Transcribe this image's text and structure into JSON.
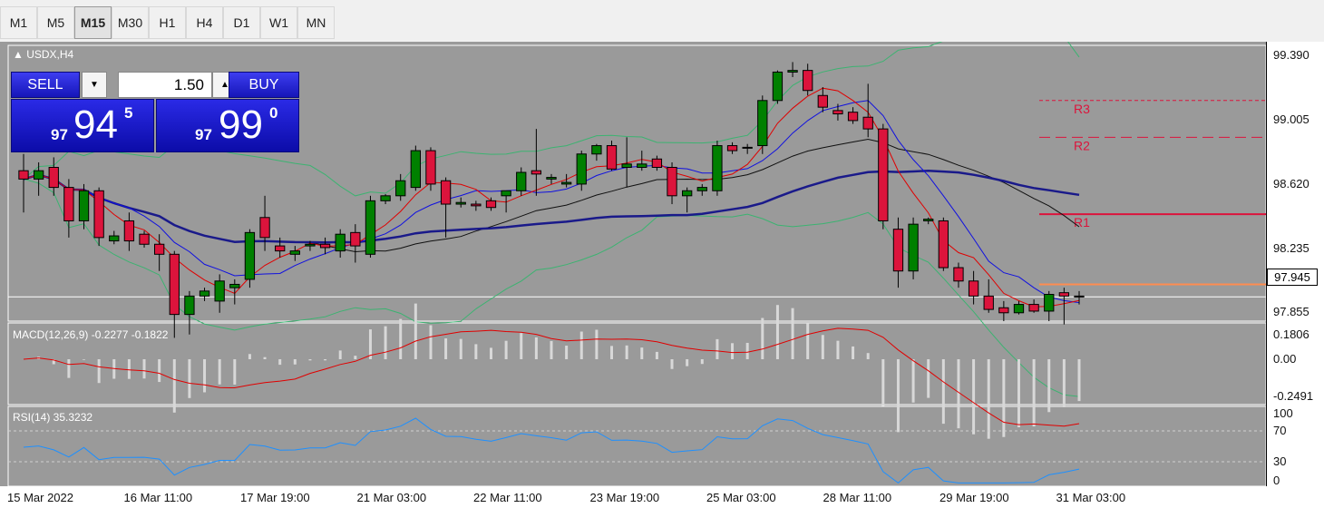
{
  "timeframes": [
    {
      "label": "M1",
      "active": false
    },
    {
      "label": "M5",
      "active": false
    },
    {
      "label": "M15",
      "active": true
    },
    {
      "label": "M30",
      "active": false
    },
    {
      "label": "H1",
      "active": false
    },
    {
      "label": "H4",
      "active": false
    },
    {
      "label": "D1",
      "active": false
    },
    {
      "label": "W1",
      "active": false
    },
    {
      "label": "MN",
      "active": false
    }
  ],
  "chart": {
    "symbol_label": "USDX,H4",
    "current_price": "97.945",
    "price_ticks": [
      "99.390",
      "99.005",
      "98.620",
      "98.235",
      "97.855"
    ],
    "pivot_labels": [
      "R3",
      "R2",
      "R1"
    ],
    "time_labels": [
      "15 Mar 2022",
      "16 Mar 11:00",
      "17 Mar 19:00",
      "21 Mar 03:00",
      "22 Mar 11:00",
      "23 Mar 19:00",
      "25 Mar 03:00",
      "28 Mar 11:00",
      "29 Mar 19:00",
      "31 Mar 03:00"
    ],
    "colors": {
      "background": "#9a9a9a",
      "bull": "#008000",
      "bear": "#dc143c",
      "macd_hist": "#d8d8d8",
      "macd_signal": "#e00000",
      "rsi": "#1e90ff",
      "pivot_r": "#dc143c",
      "pivot_pp": "#ff8c50"
    }
  },
  "trade_panel": {
    "sell_label": "SELL",
    "buy_label": "BUY",
    "lot_value": "1.50",
    "sell_price_prefix": "97",
    "sell_price_big": "94",
    "sell_price_sup": "5",
    "buy_price_prefix": "97",
    "buy_price_big": "99",
    "buy_price_sup": "0"
  },
  "macd": {
    "label": "MACD(12,26,9) -0.2277 -0.1822",
    "ticks": [
      "0.1806",
      "0.00",
      "-0.2491"
    ]
  },
  "rsi": {
    "label": "RSI(14) 35.3232",
    "ticks": [
      "100",
      "70",
      "30",
      "0"
    ]
  },
  "chart_data": {
    "type": "candlestick",
    "title": "USDX,H4",
    "ylim": [
      97.8,
      99.45
    ],
    "candles": [
      {
        "o": 98.7,
        "h": 98.8,
        "l": 98.45,
        "c": 98.65
      },
      {
        "o": 98.65,
        "h": 98.75,
        "l": 98.55,
        "c": 98.7
      },
      {
        "o": 98.72,
        "h": 98.78,
        "l": 98.55,
        "c": 98.6
      },
      {
        "o": 98.6,
        "h": 98.65,
        "l": 98.3,
        "c": 98.4
      },
      {
        "o": 98.4,
        "h": 98.62,
        "l": 98.35,
        "c": 98.58
      },
      {
        "o": 98.58,
        "h": 98.6,
        "l": 98.25,
        "c": 98.3
      },
      {
        "o": 98.28,
        "h": 98.34,
        "l": 98.26,
        "c": 98.31
      },
      {
        "o": 98.4,
        "h": 98.45,
        "l": 98.22,
        "c": 98.28
      },
      {
        "o": 98.32,
        "h": 98.34,
        "l": 98.24,
        "c": 98.26
      },
      {
        "o": 98.26,
        "h": 98.32,
        "l": 98.1,
        "c": 98.2
      },
      {
        "o": 98.2,
        "h": 98.22,
        "l": 97.7,
        "c": 97.84
      },
      {
        "o": 97.84,
        "h": 97.98,
        "l": 97.72,
        "c": 97.95
      },
      {
        "o": 97.95,
        "h": 98.0,
        "l": 97.92,
        "c": 97.98
      },
      {
        "o": 97.92,
        "h": 98.08,
        "l": 97.85,
        "c": 98.04
      },
      {
        "o": 98.0,
        "h": 98.05,
        "l": 97.9,
        "c": 98.02
      },
      {
        "o": 98.05,
        "h": 98.35,
        "l": 98.0,
        "c": 98.33
      },
      {
        "o": 98.42,
        "h": 98.55,
        "l": 98.22,
        "c": 98.3
      },
      {
        "o": 98.25,
        "h": 98.3,
        "l": 98.18,
        "c": 98.22
      },
      {
        "o": 98.2,
        "h": 98.25,
        "l": 98.16,
        "c": 98.22
      },
      {
        "o": 98.25,
        "h": 98.28,
        "l": 98.22,
        "c": 98.26
      },
      {
        "o": 98.26,
        "h": 98.3,
        "l": 98.2,
        "c": 98.24
      },
      {
        "o": 98.22,
        "h": 98.35,
        "l": 98.18,
        "c": 98.32
      },
      {
        "o": 98.33,
        "h": 98.38,
        "l": 98.15,
        "c": 98.25
      },
      {
        "o": 98.2,
        "h": 98.55,
        "l": 98.18,
        "c": 98.52
      },
      {
        "o": 98.52,
        "h": 98.56,
        "l": 98.5,
        "c": 98.55
      },
      {
        "o": 98.55,
        "h": 98.68,
        "l": 98.52,
        "c": 98.64
      },
      {
        "o": 98.6,
        "h": 98.85,
        "l": 98.58,
        "c": 98.82
      },
      {
        "o": 98.82,
        "h": 98.84,
        "l": 98.58,
        "c": 98.62
      },
      {
        "o": 98.64,
        "h": 98.66,
        "l": 98.3,
        "c": 98.5
      },
      {
        "o": 98.5,
        "h": 98.54,
        "l": 98.48,
        "c": 98.51
      },
      {
        "o": 98.5,
        "h": 98.52,
        "l": 98.46,
        "c": 98.49
      },
      {
        "o": 98.52,
        "h": 98.54,
        "l": 98.46,
        "c": 98.48
      },
      {
        "o": 98.55,
        "h": 98.58,
        "l": 98.45,
        "c": 98.58
      },
      {
        "o": 98.58,
        "h": 98.72,
        "l": 98.55,
        "c": 98.69
      },
      {
        "o": 98.7,
        "h": 98.95,
        "l": 98.55,
        "c": 98.68
      },
      {
        "o": 98.65,
        "h": 98.68,
        "l": 98.62,
        "c": 98.66
      },
      {
        "o": 98.62,
        "h": 98.68,
        "l": 98.6,
        "c": 98.63
      },
      {
        "o": 98.62,
        "h": 98.82,
        "l": 98.58,
        "c": 98.8
      },
      {
        "o": 98.8,
        "h": 98.86,
        "l": 98.76,
        "c": 98.85
      },
      {
        "o": 98.85,
        "h": 98.88,
        "l": 98.7,
        "c": 98.71
      },
      {
        "o": 98.72,
        "h": 98.9,
        "l": 98.6,
        "c": 98.74
      },
      {
        "o": 98.72,
        "h": 98.82,
        "l": 98.7,
        "c": 98.74
      },
      {
        "o": 98.77,
        "h": 98.79,
        "l": 98.7,
        "c": 98.72
      },
      {
        "o": 98.72,
        "h": 98.75,
        "l": 98.5,
        "c": 98.55
      },
      {
        "o": 98.55,
        "h": 98.6,
        "l": 98.45,
        "c": 98.58
      },
      {
        "o": 98.58,
        "h": 98.62,
        "l": 98.55,
        "c": 98.6
      },
      {
        "o": 98.58,
        "h": 98.88,
        "l": 98.55,
        "c": 98.85
      },
      {
        "o": 98.85,
        "h": 98.87,
        "l": 98.8,
        "c": 98.82
      },
      {
        "o": 98.84,
        "h": 98.86,
        "l": 98.8,
        "c": 98.84
      },
      {
        "o": 98.85,
        "h": 99.15,
        "l": 98.8,
        "c": 99.12
      },
      {
        "o": 99.12,
        "h": 99.3,
        "l": 99.1,
        "c": 99.29
      },
      {
        "o": 99.29,
        "h": 99.35,
        "l": 99.26,
        "c": 99.3
      },
      {
        "o": 99.3,
        "h": 99.34,
        "l": 99.15,
        "c": 99.18
      },
      {
        "o": 99.15,
        "h": 99.2,
        "l": 99.05,
        "c": 99.08
      },
      {
        "o": 99.06,
        "h": 99.1,
        "l": 99.0,
        "c": 99.04
      },
      {
        "o": 99.05,
        "h": 99.08,
        "l": 98.98,
        "c": 99.0
      },
      {
        "o": 99.02,
        "h": 99.22,
        "l": 98.9,
        "c": 98.95
      },
      {
        "o": 98.95,
        "h": 98.98,
        "l": 98.35,
        "c": 98.4
      },
      {
        "o": 98.35,
        "h": 98.42,
        "l": 98.0,
        "c": 98.1
      },
      {
        "o": 98.1,
        "h": 98.42,
        "l": 98.05,
        "c": 98.38
      },
      {
        "o": 98.4,
        "h": 98.42,
        "l": 98.38,
        "c": 98.41
      },
      {
        "o": 98.4,
        "h": 98.42,
        "l": 98.1,
        "c": 98.12
      },
      {
        "o": 98.12,
        "h": 98.15,
        "l": 98.0,
        "c": 98.04
      },
      {
        "o": 98.04,
        "h": 98.1,
        "l": 97.9,
        "c": 97.95
      },
      {
        "o": 97.95,
        "h": 98.05,
        "l": 97.85,
        "c": 97.87
      },
      {
        "o": 97.88,
        "h": 97.92,
        "l": 97.8,
        "c": 97.85
      },
      {
        "o": 97.85,
        "h": 97.92,
        "l": 97.84,
        "c": 97.9
      },
      {
        "o": 97.9,
        "h": 97.93,
        "l": 97.85,
        "c": 97.86
      },
      {
        "o": 97.86,
        "h": 97.98,
        "l": 97.8,
        "c": 97.96
      },
      {
        "o": 97.97,
        "h": 98.0,
        "l": 97.78,
        "c": 97.95
      },
      {
        "o": 97.95,
        "h": 97.98,
        "l": 97.9,
        "c": 97.945
      }
    ]
  }
}
